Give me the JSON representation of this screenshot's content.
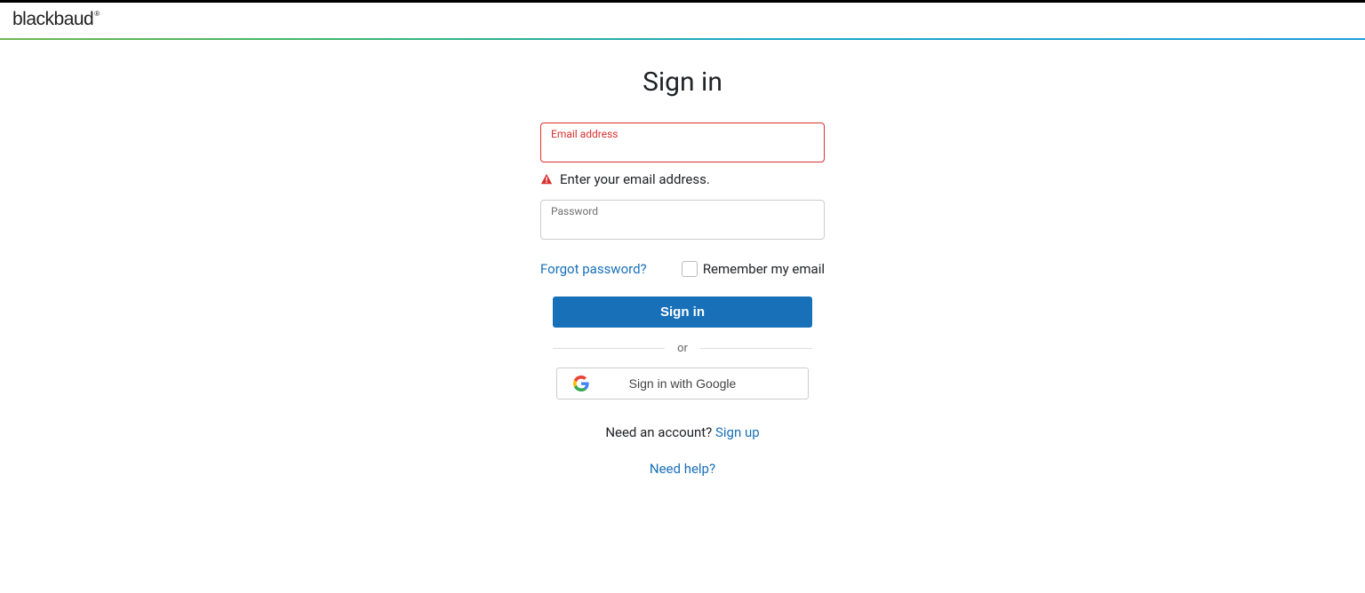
{
  "header": {
    "brand": "blackbaud"
  },
  "page": {
    "title": "Sign in"
  },
  "form": {
    "email_label": "Email address",
    "email_value": "",
    "email_error": "Enter your email address.",
    "password_label": "Password",
    "password_value": "",
    "forgot_password": "Forgot password?",
    "remember_label": "Remember my email",
    "signin_button": "Sign in",
    "divider": "or",
    "google_button": "Sign in with Google"
  },
  "footer": {
    "need_account_text": "Need an account? ",
    "signup_link": "Sign up",
    "need_help": "Need help?"
  }
}
